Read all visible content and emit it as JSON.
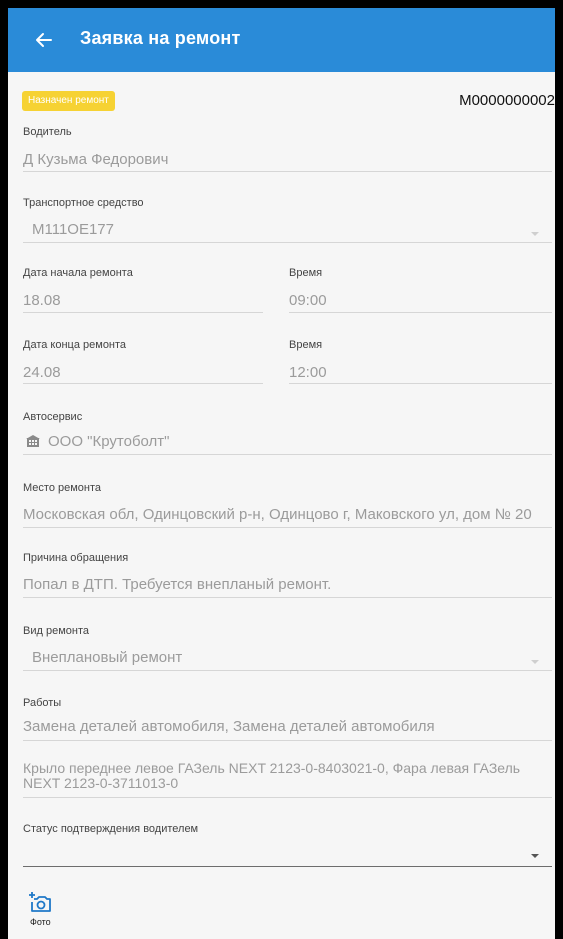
{
  "app_bar": {
    "title": "Заявка на ремонт",
    "back_icon": "arrow-left-icon",
    "color": "#2a8bd8"
  },
  "status": {
    "badge": "Назначен ремонт",
    "badge_color": "#f6d233",
    "number": "М0000000002"
  },
  "fields": {
    "driver": {
      "label": "Водитель",
      "value": "Д Кузьма Федорович"
    },
    "vehicle": {
      "label": "Транспортное средство",
      "value": "М111ОЕ177"
    },
    "start_date": {
      "label": "Дата начала ремонта",
      "value": "18.08"
    },
    "start_time": {
      "label": "Время",
      "value": "09:00"
    },
    "end_date": {
      "label": "Дата конца ремонта",
      "value": "24.08"
    },
    "end_time": {
      "label": "Время",
      "value": "12:00"
    },
    "service": {
      "label": "Автосервис",
      "value": "ООО \"Крутоболт\"",
      "icon": "building-icon"
    },
    "place": {
      "label": "Место ремонта",
      "value": "Московская обл, Одинцовский р-н, Одинцово г, Маковского ул, дом № 20"
    },
    "reason": {
      "label": "Причина обращения",
      "value": "Попал в ДТП. Требуется внепланый ремонт."
    },
    "repair_type": {
      "label": "Вид ремонта",
      "value": "Внеплановый ремонт"
    },
    "works": {
      "label": "Работы",
      "value": "Замена деталей автомобиля, Замена деталей автомобиля",
      "parts": "Крыло переднее левое ГАЗель NEXT 2123-0-8403021-0, Фара левая ГАЗель NEXT 2123-0-3711013-0"
    },
    "driver_confirm": {
      "label": "Статус подтверждения водителем",
      "value": ""
    }
  },
  "photo": {
    "label": "Фото",
    "icon": "add-photo-icon"
  }
}
